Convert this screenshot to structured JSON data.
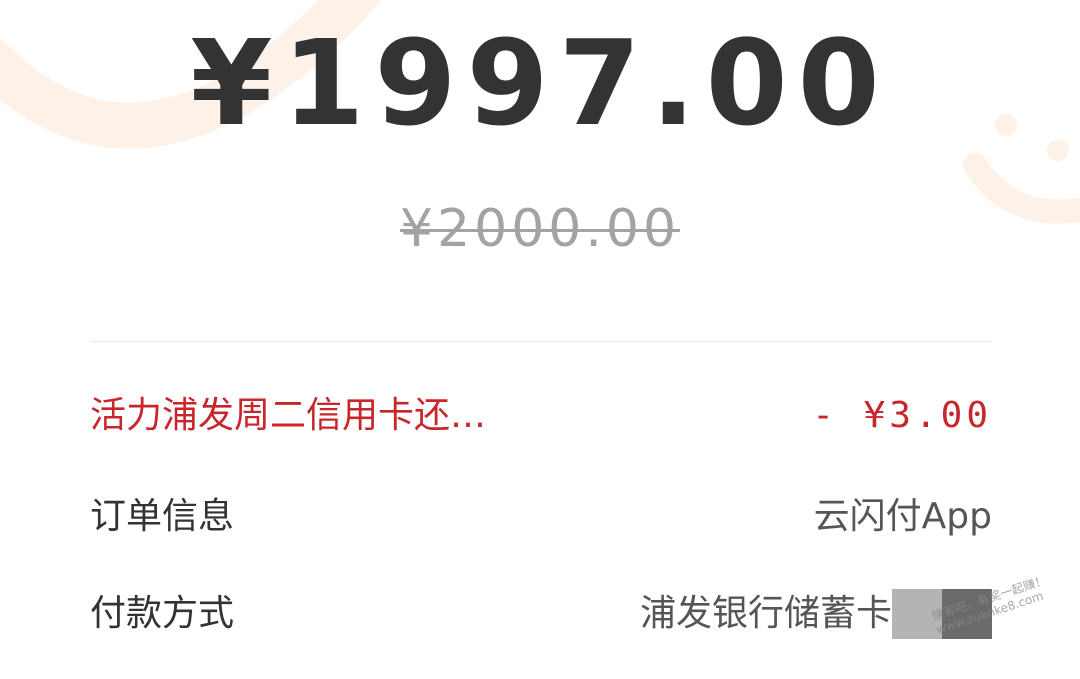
{
  "payment": {
    "amount": "¥1997.00",
    "original_amount": "¥2000.00"
  },
  "discount": {
    "label": "活力浦发周二信用卡还…",
    "value": "- ¥3.00"
  },
  "order_info": {
    "label": "订单信息",
    "value": "云闪付App"
  },
  "payment_method": {
    "label": "付款方式",
    "value": "浦发银行储蓄卡"
  },
  "watermark": {
    "line1": "赚客吧，有奖一起赚！",
    "line2": "www.zuanke8.com"
  },
  "colors": {
    "discount_red": "#c8262b",
    "decoration": "#fdf1e8"
  },
  "icons": {
    "background": "smile-face-decoration"
  }
}
